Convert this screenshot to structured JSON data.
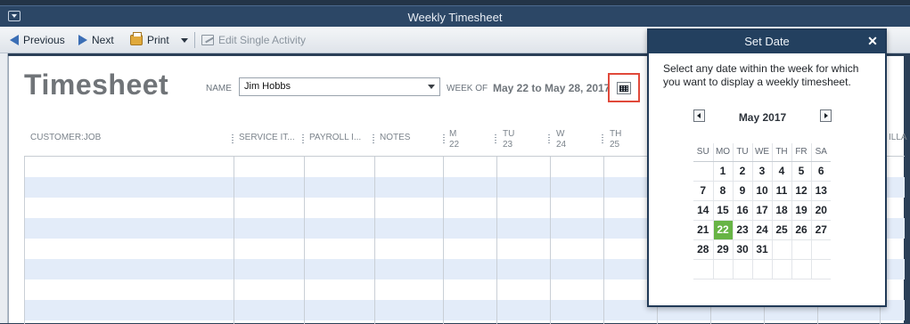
{
  "window": {
    "title": "Weekly Timesheet"
  },
  "toolbar": {
    "previous_label": "Previous",
    "next_label": "Next",
    "print_label": "Print",
    "edit_single_label": "Edit Single Activity"
  },
  "timesheet": {
    "title": "Timesheet",
    "name_label": "NAME",
    "name_value": "Jim  Hobbs",
    "week_label": "WEEK OF",
    "week_value": "May 22 to May 28, 2017"
  },
  "columns": {
    "customer_job": "CUSTOMER:JOB",
    "service_item": "SERVICE IT...",
    "payroll_item": "PAYROLL I...",
    "notes": "NOTES",
    "days": [
      {
        "dow": "M",
        "day": "22"
      },
      {
        "dow": "TU",
        "day": "23"
      },
      {
        "dow": "W",
        "day": "24"
      },
      {
        "dow": "TH",
        "day": "25"
      }
    ],
    "billable_fragment": "ILLA"
  },
  "popup": {
    "title": "Set Date",
    "close_glyph": "✕",
    "description": "Select any date within the week for which you want to display a weekly timesheet.",
    "month": "May 2017",
    "weekdays": [
      "SU",
      "MO",
      "TU",
      "WE",
      "TH",
      "FR",
      "SA"
    ],
    "weeks": [
      [
        "",
        "1",
        "2",
        "3",
        "4",
        "5",
        "6"
      ],
      [
        "7",
        "8",
        "9",
        "10",
        "11",
        "12",
        "13"
      ],
      [
        "14",
        "15",
        "16",
        "17",
        "18",
        "19",
        "20"
      ],
      [
        "21",
        "22",
        "23",
        "24",
        "25",
        "26",
        "27"
      ],
      [
        "28",
        "29",
        "30",
        "31",
        "",
        "",
        ""
      ],
      [
        "",
        "",
        "",
        "",
        "",
        "",
        ""
      ]
    ],
    "selected_day": "22",
    "selected_color": "#67b445"
  },
  "icons": {
    "previous": "arrow-left-icon",
    "next": "arrow-right-icon",
    "print": "printer-icon",
    "edit": "pencil-icon",
    "calendar": "calendar-icon",
    "close": "close-icon"
  },
  "colors": {
    "titlebar": "#2c4766",
    "alt_row": "#e3ecf9",
    "highlight_border": "#e0493a"
  }
}
